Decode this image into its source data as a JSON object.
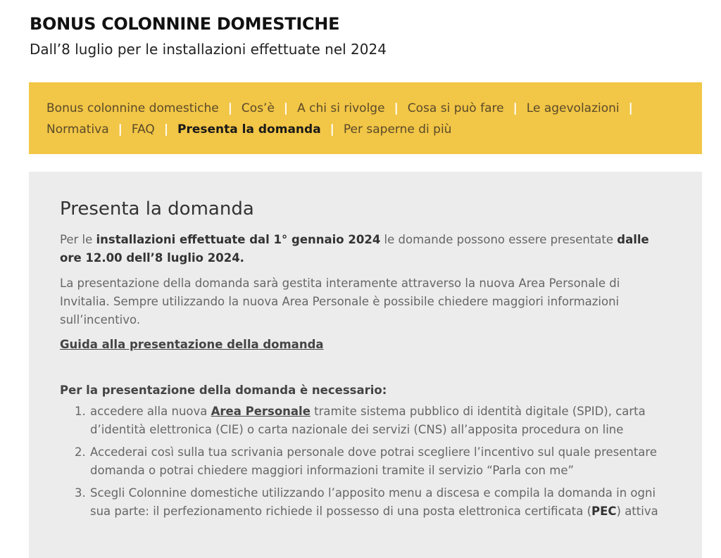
{
  "header": {
    "title": "BONUS COLONNINE DOMESTICHE",
    "subtitle": "Dall’8 luglio per le installazioni effettuate nel 2024"
  },
  "nav": {
    "items": [
      {
        "label": "Bonus colonnine domestiche"
      },
      {
        "label": "Cos’è"
      },
      {
        "label": "A chi si rivolge"
      },
      {
        "label": "Cosa si può fare"
      },
      {
        "label": "Le agevolazioni"
      },
      {
        "label": "Normativa"
      },
      {
        "label": "FAQ"
      },
      {
        "label": "Presenta la domanda"
      },
      {
        "label": "Per saperne di più"
      }
    ],
    "separator": "|"
  },
  "main": {
    "title": "Presenta la domanda",
    "para1": {
      "t1": "Per le ",
      "b1": "installazioni effettuate dal 1° gennaio 2024",
      "t2": " le domande possono essere presentate ",
      "b2": "dalle ore 12.00 dell’8 luglio 2024."
    },
    "para2": "La presentazione della domanda sarà gestita interamente attraverso la nuova Area Personale di Invitalia. Sempre utilizzando la nuova Area Personale è possibile chiedere maggiori informazioni sull’incentivo.",
    "guide_link": "Guida alla presentazione della domanda",
    "req_heading": "Per la presentazione della domanda è necessario:",
    "steps": {
      "s1": {
        "t1": "accedere alla nuova ",
        "link": "Area Personale",
        "t2": " tramite sistema pubblico di identità digitale (SPID), carta d’identità elettronica (CIE) o carta nazionale dei servizi (CNS) all’apposita procedura on line"
      },
      "s2": "Accederai così sulla tua scrivania personale dove potrai scegliere l’incentivo sul quale presentare domanda o potrai chiedere maggiori informazioni tramite il servizio “Parla con me”",
      "s3": {
        "t1": "Scegli Colonnine domestiche utilizzando l’apposito menu a discesa e compila la domanda in ogni sua parte: il perfezionamento richiede il possesso di una posta elettronica certificata (",
        "b": "PEC",
        "t2": ") attiva"
      }
    }
  },
  "colors": {
    "nav_background": "#f2c646",
    "content_background": "#ececec"
  }
}
